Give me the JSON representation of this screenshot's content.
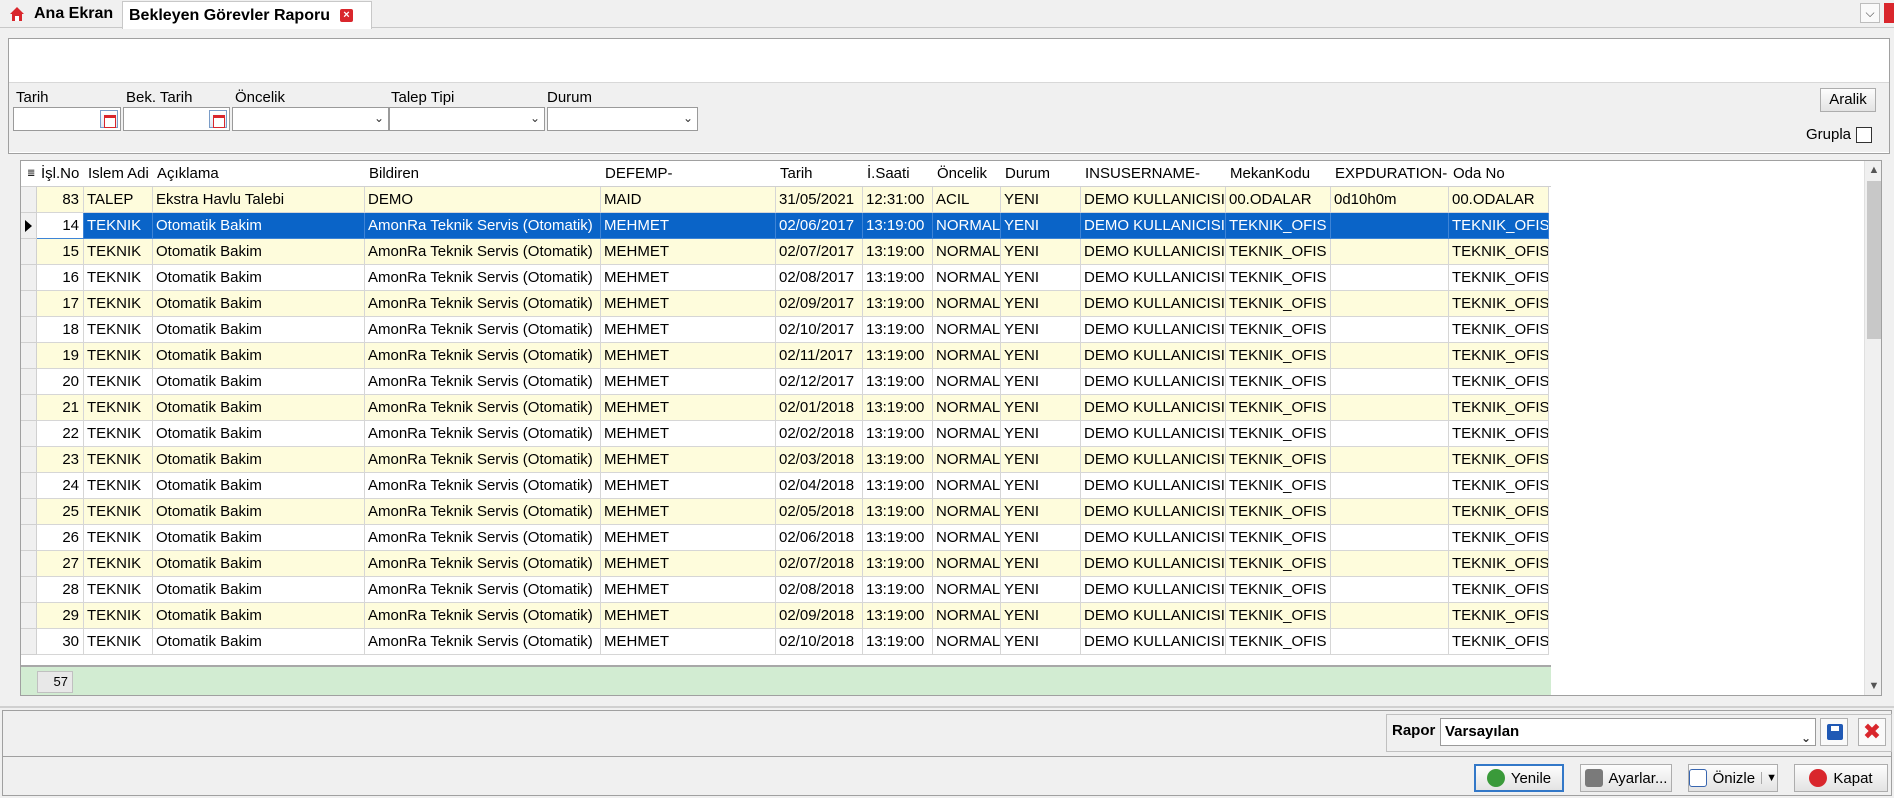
{
  "tabs": {
    "home": "Ana Ekran",
    "active": "Bekleyen Görevler Raporu",
    "close_glyph": "×"
  },
  "filters": {
    "tarih_label": "Tarih",
    "bek_tarih_label": "Bek. Tarih",
    "oncelik_label": "Öncelik",
    "talep_tipi_label": "Talep Tipi",
    "durum_label": "Durum",
    "aralik_button": "Aralik",
    "grupla_label": "Grupla"
  },
  "grid": {
    "columns": [
      "İşl.No",
      "Islem Adi",
      "Açıklama",
      "Bildiren",
      "DEFEMP-",
      "Tarih",
      "İ.Saati",
      "Öncelik",
      "Durum",
      "INSUSERNAME-",
      "MekanKodu",
      "EXPDURATION-",
      "Oda No"
    ],
    "rows": [
      [
        "83",
        "TALEP",
        "Ekstra Havlu Talebi",
        "DEMO",
        "MAID",
        "31/05/2021",
        "12:31:00",
        "ACIL",
        "YENI",
        "DEMO KULLANICISI",
        "00.ODALAR",
        "0d10h0m",
        "00.ODALAR"
      ],
      [
        "14",
        "TEKNIK",
        "Otomatik Bakim",
        "AmonRa Teknik Servis (Otomatik)",
        "MEHMET",
        "02/06/2017",
        "13:19:00",
        "NORMAL",
        "YENI",
        "DEMO KULLANICISI",
        "TEKNIK_OFIS",
        "",
        "TEKNIK_OFIS"
      ],
      [
        "15",
        "TEKNIK",
        "Otomatik Bakim",
        "AmonRa Teknik Servis (Otomatik)",
        "MEHMET",
        "02/07/2017",
        "13:19:00",
        "NORMAL",
        "YENI",
        "DEMO KULLANICISI",
        "TEKNIK_OFIS",
        "",
        "TEKNIK_OFIS"
      ],
      [
        "16",
        "TEKNIK",
        "Otomatik Bakim",
        "AmonRa Teknik Servis (Otomatik)",
        "MEHMET",
        "02/08/2017",
        "13:19:00",
        "NORMAL",
        "YENI",
        "DEMO KULLANICISI",
        "TEKNIK_OFIS",
        "",
        "TEKNIK_OFIS"
      ],
      [
        "17",
        "TEKNIK",
        "Otomatik Bakim",
        "AmonRa Teknik Servis (Otomatik)",
        "MEHMET",
        "02/09/2017",
        "13:19:00",
        "NORMAL",
        "YENI",
        "DEMO KULLANICISI",
        "TEKNIK_OFIS",
        "",
        "TEKNIK_OFIS"
      ],
      [
        "18",
        "TEKNIK",
        "Otomatik Bakim",
        "AmonRa Teknik Servis (Otomatik)",
        "MEHMET",
        "02/10/2017",
        "13:19:00",
        "NORMAL",
        "YENI",
        "DEMO KULLANICISI",
        "TEKNIK_OFIS",
        "",
        "TEKNIK_OFIS"
      ],
      [
        "19",
        "TEKNIK",
        "Otomatik Bakim",
        "AmonRa Teknik Servis (Otomatik)",
        "MEHMET",
        "02/11/2017",
        "13:19:00",
        "NORMAL",
        "YENI",
        "DEMO KULLANICISI",
        "TEKNIK_OFIS",
        "",
        "TEKNIK_OFIS"
      ],
      [
        "20",
        "TEKNIK",
        "Otomatik Bakim",
        "AmonRa Teknik Servis (Otomatik)",
        "MEHMET",
        "02/12/2017",
        "13:19:00",
        "NORMAL",
        "YENI",
        "DEMO KULLANICISI",
        "TEKNIK_OFIS",
        "",
        "TEKNIK_OFIS"
      ],
      [
        "21",
        "TEKNIK",
        "Otomatik Bakim",
        "AmonRa Teknik Servis (Otomatik)",
        "MEHMET",
        "02/01/2018",
        "13:19:00",
        "NORMAL",
        "YENI",
        "DEMO KULLANICISI",
        "TEKNIK_OFIS",
        "",
        "TEKNIK_OFIS"
      ],
      [
        "22",
        "TEKNIK",
        "Otomatik Bakim",
        "AmonRa Teknik Servis (Otomatik)",
        "MEHMET",
        "02/02/2018",
        "13:19:00",
        "NORMAL",
        "YENI",
        "DEMO KULLANICISI",
        "TEKNIK_OFIS",
        "",
        "TEKNIK_OFIS"
      ],
      [
        "23",
        "TEKNIK",
        "Otomatik Bakim",
        "AmonRa Teknik Servis (Otomatik)",
        "MEHMET",
        "02/03/2018",
        "13:19:00",
        "NORMAL",
        "YENI",
        "DEMO KULLANICISI",
        "TEKNIK_OFIS",
        "",
        "TEKNIK_OFIS"
      ],
      [
        "24",
        "TEKNIK",
        "Otomatik Bakim",
        "AmonRa Teknik Servis (Otomatik)",
        "MEHMET",
        "02/04/2018",
        "13:19:00",
        "NORMAL",
        "YENI",
        "DEMO KULLANICISI",
        "TEKNIK_OFIS",
        "",
        "TEKNIK_OFIS"
      ],
      [
        "25",
        "TEKNIK",
        "Otomatik Bakim",
        "AmonRa Teknik Servis (Otomatik)",
        "MEHMET",
        "02/05/2018",
        "13:19:00",
        "NORMAL",
        "YENI",
        "DEMO KULLANICISI",
        "TEKNIK_OFIS",
        "",
        "TEKNIK_OFIS"
      ],
      [
        "26",
        "TEKNIK",
        "Otomatik Bakim",
        "AmonRa Teknik Servis (Otomatik)",
        "MEHMET",
        "02/06/2018",
        "13:19:00",
        "NORMAL",
        "YENI",
        "DEMO KULLANICISI",
        "TEKNIK_OFIS",
        "",
        "TEKNIK_OFIS"
      ],
      [
        "27",
        "TEKNIK",
        "Otomatik Bakim",
        "AmonRa Teknik Servis (Otomatik)",
        "MEHMET",
        "02/07/2018",
        "13:19:00",
        "NORMAL",
        "YENI",
        "DEMO KULLANICISI",
        "TEKNIK_OFIS",
        "",
        "TEKNIK_OFIS"
      ],
      [
        "28",
        "TEKNIK",
        "Otomatik Bakim",
        "AmonRa Teknik Servis (Otomatik)",
        "MEHMET",
        "02/08/2018",
        "13:19:00",
        "NORMAL",
        "YENI",
        "DEMO KULLANICISI",
        "TEKNIK_OFIS",
        "",
        "TEKNIK_OFIS"
      ],
      [
        "29",
        "TEKNIK",
        "Otomatik Bakim",
        "AmonRa Teknik Servis (Otomatik)",
        "MEHMET",
        "02/09/2018",
        "13:19:00",
        "NORMAL",
        "YENI",
        "DEMO KULLANICISI",
        "TEKNIK_OFIS",
        "",
        "TEKNIK_OFIS"
      ],
      [
        "30",
        "TEKNIK",
        "Otomatik Bakim",
        "AmonRa Teknik Servis (Otomatik)",
        "MEHMET",
        "02/10/2018",
        "13:19:00",
        "NORMAL",
        "YENI",
        "DEMO KULLANICISI",
        "TEKNIK_OFIS",
        "",
        "TEKNIK_OFIS"
      ]
    ],
    "selected_row": 1,
    "footer_count": "57"
  },
  "bottom": {
    "rapor_label": "Rapor",
    "rapor_value": "Varsayılan",
    "yenile": "Yenile",
    "ayarlar": "Ayarlar...",
    "onizle": "Önizle",
    "kapat": "Kapat"
  },
  "colors": {
    "selection": "#0a64c8",
    "row_alt": "#fefcdc",
    "footer": "#d2ecd2",
    "danger": "#d9262c"
  }
}
